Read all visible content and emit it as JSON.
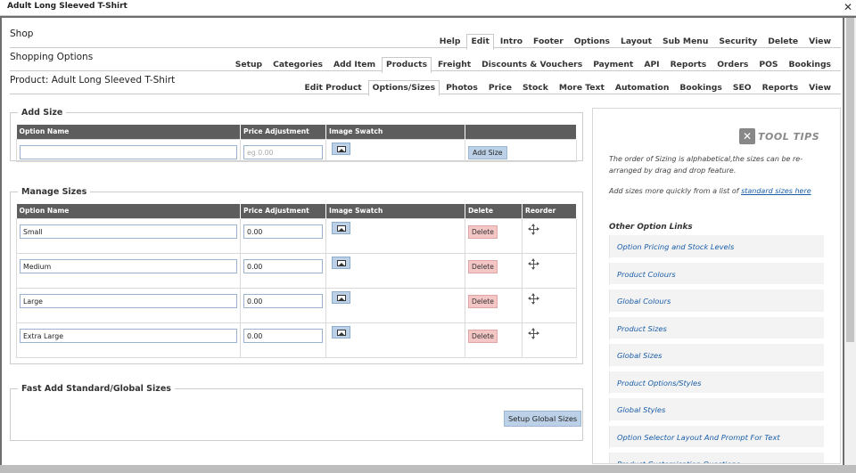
{
  "window": {
    "title": "Adult Long Sleeved T-Shirt",
    "close_label": "✕"
  },
  "shop_nav": {
    "label": "Shop",
    "tabs": [
      "Help",
      "Edit",
      "Intro",
      "Footer",
      "Options",
      "Layout",
      "Sub Menu",
      "Security",
      "Delete",
      "View"
    ],
    "active": "Edit"
  },
  "shopping_nav": {
    "label": "Shopping Options",
    "tabs": [
      "Setup",
      "Categories",
      "Add Item",
      "Products",
      "Freight",
      "Discounts & Vouchers",
      "Payment",
      "API",
      "Reports",
      "Orders",
      "POS",
      "Bookings"
    ],
    "active": "Products"
  },
  "product_nav": {
    "label": "Product: Adult Long Sleeved T-Shirt",
    "tabs": [
      "Edit Product",
      "Options/Sizes",
      "Photos",
      "Price",
      "Stock",
      "More Text",
      "Automation",
      "Bookings",
      "SEO",
      "Reports",
      "View"
    ],
    "active": "Options/Sizes"
  },
  "add_size": {
    "legend": "Add Size",
    "headers": [
      "Option Name",
      "Price Adjustment",
      "Image Swatch",
      ""
    ],
    "name_value": "",
    "price_placeholder": "eg 0.00",
    "button": "Add Size"
  },
  "manage_sizes": {
    "legend": "Manage Sizes",
    "headers": [
      "Option Name",
      "Price Adjustment",
      "Image Swatch",
      "Delete",
      "Reorder"
    ],
    "delete_label": "Delete",
    "rows": [
      {
        "name": "Small",
        "price": "0.00"
      },
      {
        "name": "Medium",
        "price": "0.00"
      },
      {
        "name": "Large",
        "price": "0.00"
      },
      {
        "name": "Extra Large",
        "price": "0.00"
      }
    ]
  },
  "fast_add": {
    "legend": "Fast Add Standard/Global Sizes",
    "button": "Setup Global Sizes"
  },
  "tooltips": {
    "title": "TOOL TIPS",
    "icon": "tools-icon",
    "tip1": "The order of Sizing is alphabetical,the sizes can be re-arranged by drag and drop feature.",
    "tip2_prefix": "Add sizes more quickly from a list of ",
    "tip2_link": "standard sizes here",
    "other_links_title": "Other Option Links",
    "links": [
      "Option Pricing and Stock Levels",
      "Product Colours",
      "Global Colours",
      "Product Sizes",
      "Global Sizes",
      "Product Options/Styles",
      "Global Styles",
      "Option Selector Layout And Prompt For Text",
      "Product Customisation Questions"
    ]
  }
}
